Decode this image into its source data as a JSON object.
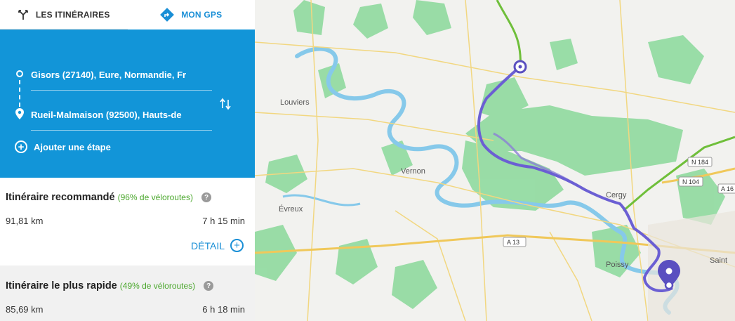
{
  "tabs": {
    "routes_label": "LES ITINÉRAIRES",
    "gps_label": "MON GPS"
  },
  "route": {
    "origin": "Gisors (27140), Eure, Normandie, Fr",
    "destination": "Rueil-Malmaison (92500), Hauts-de",
    "add_step": "Ajouter une étape"
  },
  "itineraries": [
    {
      "title": "Itinéraire recommandé",
      "bike_share": "(96% de véloroutes)",
      "distance": "91,81 km",
      "duration": "7 h 15 min",
      "detail_label": "DÉTAIL"
    },
    {
      "title": "Itinéraire le plus rapide",
      "bike_share": "(49% de véloroutes)",
      "distance": "85,69 km",
      "duration": "6 h 18 min"
    }
  ],
  "map": {
    "towns": [
      "Louviers",
      "Vernon",
      "Évreux",
      "Cergy",
      "Poissy",
      "Saint"
    ],
    "roads": [
      "A 13",
      "N 184",
      "N 104",
      "A 16"
    ],
    "colors": {
      "route_primary": "#6b5fd3",
      "route_alt": "#8a7fd6",
      "forest": "#7fd68f",
      "water": "#7ec8ea",
      "cycle_path": "#6fbf3a"
    }
  }
}
